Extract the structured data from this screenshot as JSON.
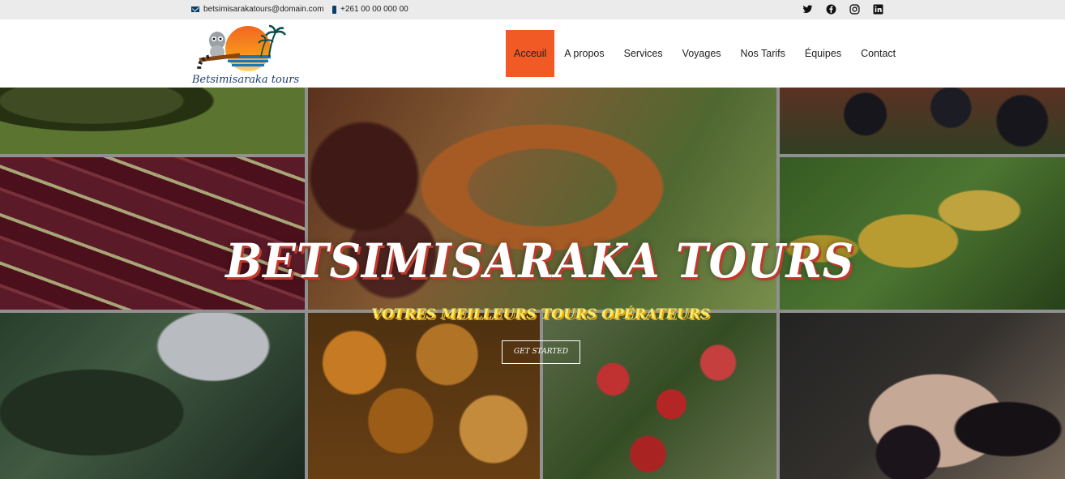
{
  "topbar": {
    "email": "betsimisarakatours@domain.com",
    "phone": "+261 00 00 000 00",
    "socials": [
      "twitter-icon",
      "facebook-icon",
      "instagram-icon",
      "linkedin-icon"
    ]
  },
  "header": {
    "logo_text": "Betsimisaraka tours",
    "nav": [
      "Acceuil",
      "A propos",
      "Services",
      "Voyages",
      "Nos Tarifs",
      "Équipes",
      "Contact"
    ],
    "active_nav": "Acceuil"
  },
  "hero": {
    "title": "BETSIMISARAKA TOURS",
    "subtitle": "VOTRES MEILLEURS TOURS OPÉRATEURS",
    "cta_label": "GET STARTED"
  },
  "colors": {
    "accent": "#f15a24",
    "brand_blue": "#1c3f6e",
    "subtitle_yellow": "#f4ec6c"
  }
}
